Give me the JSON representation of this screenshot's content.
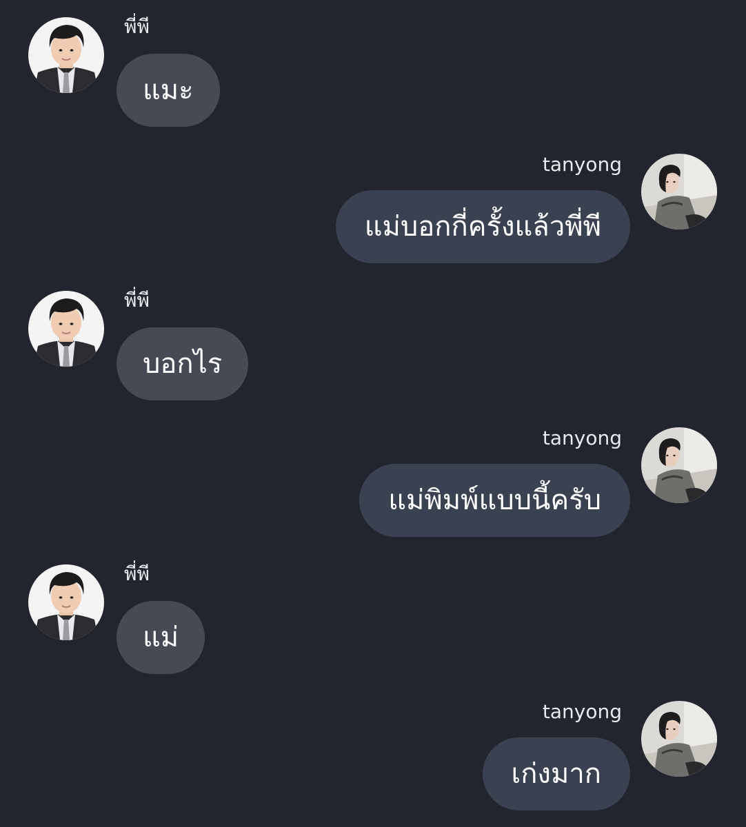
{
  "messages": [
    {
      "sender": "พี่พี",
      "text": "แมะ",
      "direction": "incoming"
    },
    {
      "sender": "tanyong",
      "text": "แม่บอกกี่ครั้งแล้วพี่พี",
      "direction": "outgoing"
    },
    {
      "sender": "พี่พี",
      "text": "บอกไร",
      "direction": "incoming"
    },
    {
      "sender": "tanyong",
      "text": "แม่พิมพ์แบบนี้ครับ",
      "direction": "outgoing"
    },
    {
      "sender": "พี่พี",
      "text": "แม่",
      "direction": "incoming"
    },
    {
      "sender": "tanyong",
      "text": "เก่งมาก",
      "direction": "outgoing"
    }
  ],
  "colors": {
    "background": "#22252e",
    "incoming_bubble": "#464a54",
    "outgoing_bubble": "#3a4151",
    "text": "#ffffff"
  },
  "icons": {
    "incoming_avatar": "boy-avatar-photo",
    "outgoing_avatar": "woman-avatar-photo"
  }
}
